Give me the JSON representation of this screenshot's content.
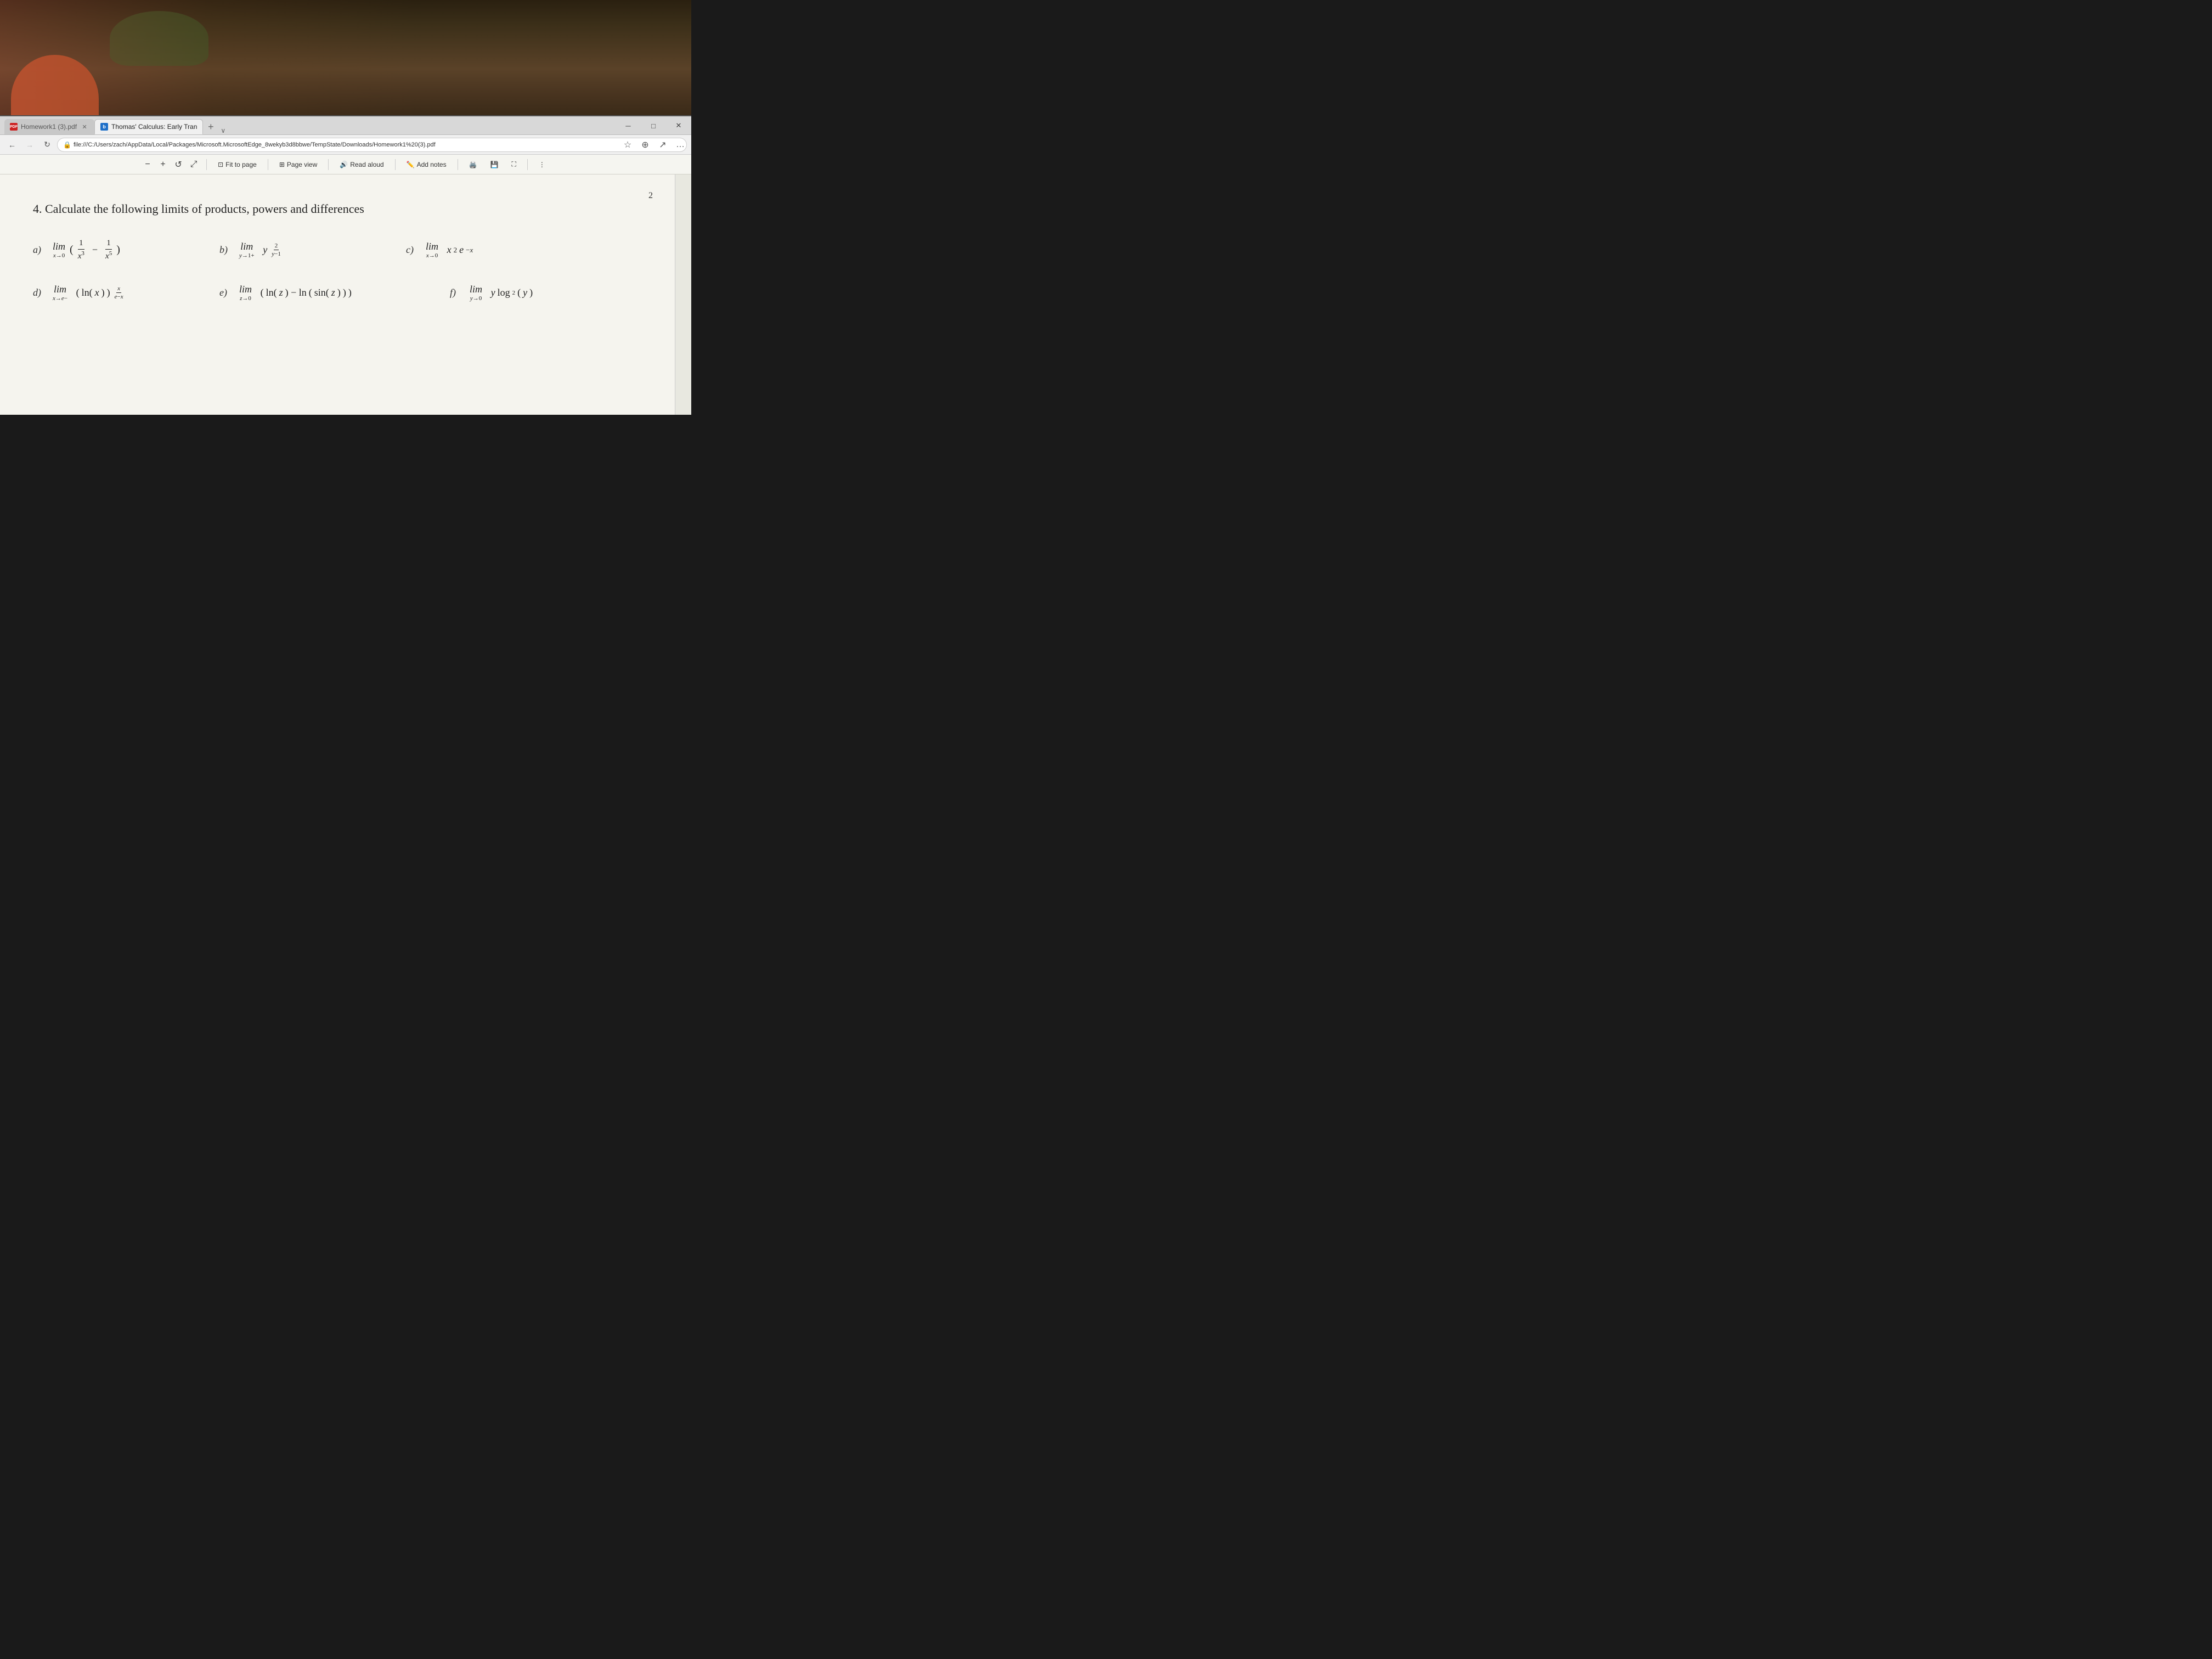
{
  "browser": {
    "tabs": [
      {
        "id": "tab-pdf",
        "label": "Homework1 (3).pdf",
        "type": "pdf",
        "active": false,
        "closable": true
      },
      {
        "id": "tab-book",
        "label": "Thomas' Calculus: Early Tran",
        "type": "book",
        "active": true,
        "closable": false
      }
    ],
    "tab_add_label": "+",
    "tab_chevron_label": "∨",
    "address": "file:///C:/Users/zach/AppData/Local/Packages/Microsoft.MicrosoftEdge_8wekyb3d8bbwe/TempState/Downloads/Homework1%20(3).pdf",
    "window_controls": {
      "minimize": "─",
      "maximize": "□",
      "close": "✕"
    }
  },
  "toolbar": {
    "zoom_minus": "−",
    "zoom_plus": "+",
    "rotate_label": "↺",
    "fit_to_page_label": "Fit to page",
    "page_view_label": "Page view",
    "read_aloud_label": "Read aloud",
    "add_notes_label": "Add notes"
  },
  "right_icons": {
    "star": "☆",
    "bookmark": "⊕",
    "share": "↗",
    "more": "…"
  },
  "pdf": {
    "page_number": "2",
    "problem_title": "4.  Calculate the following limits of products, powers and differences",
    "problems": [
      {
        "label": "a)",
        "math_html": "lim<sub>x→0</sub>&thinsp;(1/x³ − 1/x⁵)"
      },
      {
        "label": "b)",
        "math_html": "lim<sub>y→1+</sub>&thinsp;y<sup>2/(y−1)</sup>"
      },
      {
        "label": "c)",
        "math_html": "lim<sub>x→0</sub>&thinsp;x²e<sup>−x</sup>"
      },
      {
        "label": "d)",
        "math_html": "lim<sub>x→e−</sub>&thinsp;(ln(x))<sup>x/(e−x)</sup>"
      },
      {
        "label": "e)",
        "math_html": "lim<sub>z→0</sub>&thinsp;(ln(z) − ln(sin(z)))"
      },
      {
        "label": "f)",
        "math_html": "lim<sub>y→0</sub>&thinsp;y log₂(y)"
      }
    ]
  }
}
